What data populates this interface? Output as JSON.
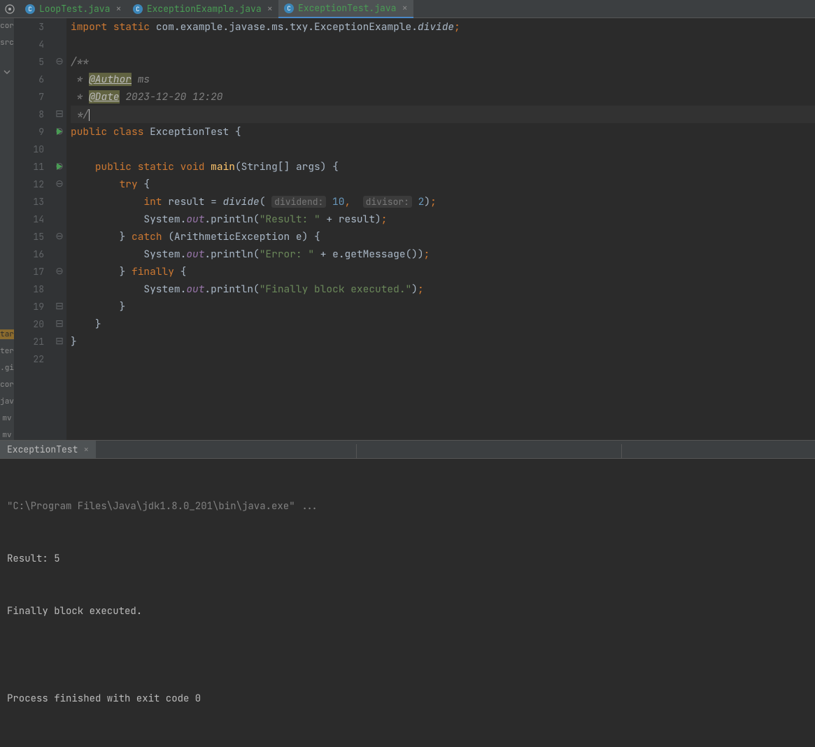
{
  "tabs": [
    {
      "name": "LoopTest.java"
    },
    {
      "name": "ExceptionExample.java"
    },
    {
      "name": "ExceptionTest.java",
      "active": true
    }
  ],
  "projectStrip": [
    "cor",
    "src",
    "",
    "",
    "",
    "",
    "",
    "",
    "",
    "",
    "",
    "",
    "",
    "",
    "",
    "",
    "",
    "tar",
    "ter",
    ".gi",
    "cor",
    "jav",
    "mv",
    "mv"
  ],
  "gutter": {
    "start": 3,
    "end": 22
  },
  "code": {
    "importLine": {
      "kw1": "import",
      "kw2": "static",
      "pkg": "com.example.javase.ms.txy.ExceptionExample.",
      "fn": "divide",
      "semi": ";"
    },
    "docOpen": "/**",
    "authorTag": "@Author",
    "authorVal": "ms",
    "dateTag": "@Date",
    "dateVal": "2023-12-20 12:20",
    "docClose": " */",
    "classDecl": {
      "kw1": "public",
      "kw2": "class",
      "name": "ExceptionTest",
      "brace": "{"
    },
    "mainDecl": {
      "kw1": "public",
      "kw2": "static",
      "kw3": "void",
      "name": "main",
      "params": "(String[] args) {"
    },
    "tryKw": "try",
    "intKw": "int",
    "resultVar": "result",
    "divideFn": "divide",
    "hint1": "dividend:",
    "arg1": "10",
    "hint2": "divisor:",
    "arg2": "2",
    "sys": "System",
    "out": "out",
    "println": "println",
    "resStr": "\"Result: \"",
    "catchKw": "catch",
    "excType": "ArithmeticException",
    "excVar": "e",
    "errStr": "\"Error: \"",
    "getMsg": "getMessage",
    "finallyKw": "finally",
    "finStr": "\"Finally block executed.\""
  },
  "bottomTab": "ExceptionTest",
  "console": {
    "l1": "\"C:\\Program Files\\Java\\jdk1.8.0_201\\bin\\java.exe\" ...",
    "l2": "Result: 5",
    "l3": "Finally block executed.",
    "l4": "",
    "l5": "Process finished with exit code 0"
  }
}
